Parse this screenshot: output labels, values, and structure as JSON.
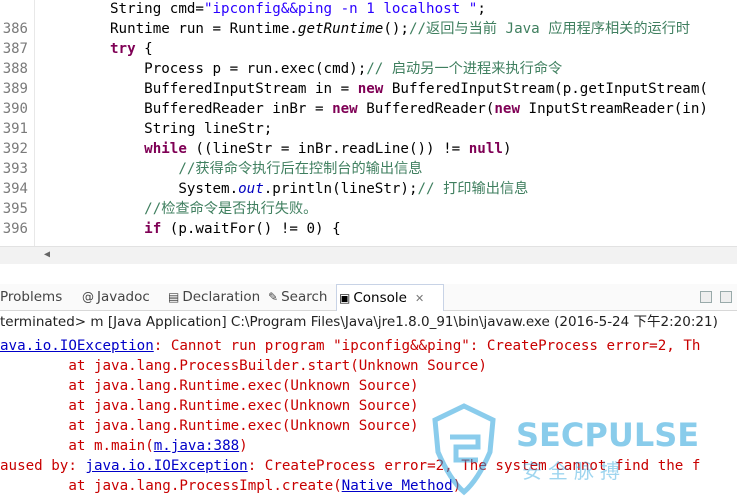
{
  "editor": {
    "lines": [
      {
        "no": "",
        "segments": [
          [
            "",
            "String cmd="
          ],
          [
            "str",
            "\"ipconfig&&ping -n 1 localhost \""
          ],
          [
            "",
            ";"
          ]
        ]
      },
      {
        "no": "386",
        "segments": [
          [
            "",
            "Runtime run = Runtime."
          ],
          [
            "it",
            "getRuntime"
          ],
          [
            "",
            "();"
          ],
          [
            "cm",
            "//返回与当前 Java 应用程序相关的运行时"
          ]
        ]
      },
      {
        "no": "387",
        "segments": [
          [
            "kw",
            "try"
          ],
          [
            "",
            " {"
          ]
        ]
      },
      {
        "no": "388",
        "segments": [
          [
            "",
            "    Process p = run.exec(cmd);"
          ],
          [
            "cm",
            "// 启动另一个进程来执行命令"
          ]
        ]
      },
      {
        "no": "389",
        "segments": [
          [
            "",
            "    BufferedInputStream in = "
          ],
          [
            "kw",
            "new"
          ],
          [
            "",
            " BufferedInputStream(p.getInputStream("
          ]
        ]
      },
      {
        "no": "390",
        "segments": [
          [
            "",
            "    BufferedReader inBr = "
          ],
          [
            "kw",
            "new"
          ],
          [
            "",
            " BufferedReader("
          ],
          [
            "kw",
            "new"
          ],
          [
            "",
            " InputStreamReader(in)"
          ]
        ]
      },
      {
        "no": "391",
        "segments": [
          [
            "",
            "    String lineStr;"
          ]
        ]
      },
      {
        "no": "392",
        "segments": [
          [
            "",
            "    "
          ],
          [
            "kw",
            "while"
          ],
          [
            "",
            " ((lineStr = inBr.readLine()) != "
          ],
          [
            "kw",
            "null"
          ],
          [
            "",
            ")"
          ]
        ]
      },
      {
        "no": "393",
        "segments": [
          [
            "cm",
            "        //获得命令执行后在控制台的输出信息"
          ]
        ]
      },
      {
        "no": "394",
        "segments": [
          [
            "",
            "        System."
          ],
          [
            "fld",
            "out"
          ],
          [
            "",
            ".println(lineStr);"
          ],
          [
            "cm",
            "// 打印输出信息"
          ]
        ]
      },
      {
        "no": "395",
        "segments": [
          [
            "cm",
            "    //检查命令是否执行失败。"
          ]
        ]
      },
      {
        "no": "396",
        "segments": [
          [
            "",
            "    "
          ],
          [
            "kw",
            "if"
          ],
          [
            "",
            " (p.waitFor() != 0) {"
          ]
        ]
      }
    ]
  },
  "tabs": [
    {
      "label": "Problems",
      "icon": "problems-icon",
      "glyph": "⚠"
    },
    {
      "label": "Javadoc",
      "icon": "javadoc-icon",
      "glyph": "@"
    },
    {
      "label": "Declaration",
      "icon": "declaration-icon",
      "glyph": "▤"
    },
    {
      "label": "Search",
      "icon": "search-icon",
      "glyph": "✎"
    },
    {
      "label": "Console",
      "icon": "console-icon",
      "glyph": "▣",
      "close": "✕"
    }
  ],
  "console": {
    "status": "terminated> m [Java Application] C:\\Program Files\\Java\\jre1.8.0_91\\bin\\javaw.exe (2016-5-24 下午2:20:21)",
    "lines": [
      [
        [
          "link",
          "ava.io.IOException"
        ],
        [
          "",
          ": Cannot run program \"ipconfig&&ping\": CreateProcess error=2, Th"
        ]
      ],
      [
        [
          "",
          "        at java.lang.ProcessBuilder.start(Unknown Source)"
        ]
      ],
      [
        [
          "",
          "        at java.lang.Runtime.exec(Unknown Source)"
        ]
      ],
      [
        [
          "",
          "        at java.lang.Runtime.exec(Unknown Source)"
        ]
      ],
      [
        [
          "",
          "        at java.lang.Runtime.exec(Unknown Source)"
        ]
      ],
      [
        [
          "",
          "        at m.main("
        ],
        [
          "link",
          "m.java:388"
        ],
        [
          "",
          ")"
        ]
      ],
      [
        [
          "",
          "aused by: "
        ],
        [
          "link",
          "java.io.IOException"
        ],
        [
          "",
          ": CreateProcess error=2, The system cannot find the f"
        ]
      ],
      [
        [
          "",
          "        at java.lang.ProcessImpl.create("
        ],
        [
          "link",
          "Native Method"
        ],
        [
          "",
          ")"
        ]
      ]
    ]
  },
  "watermark": {
    "text": "SECPULSE",
    "subtext": "安全脉搏"
  }
}
